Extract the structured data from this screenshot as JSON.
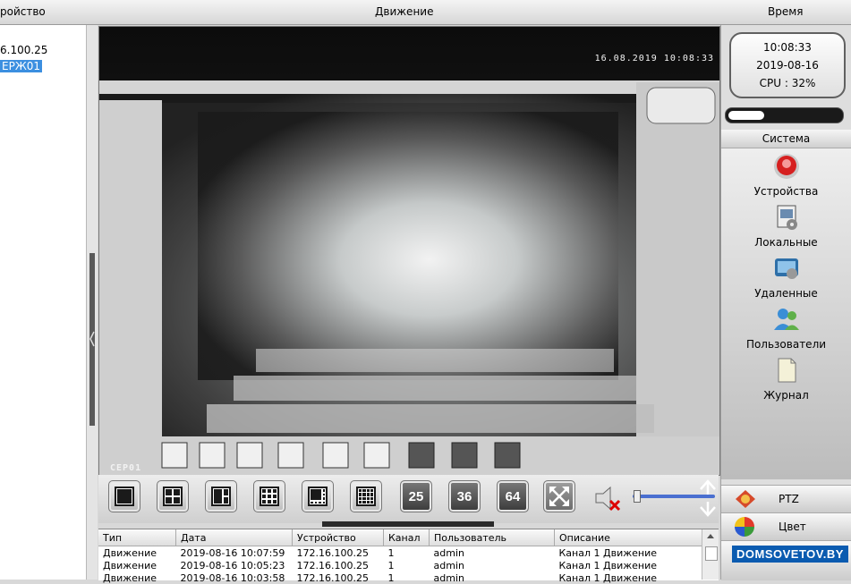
{
  "header": {
    "col_device": "ройство",
    "col_motion": "Движение",
    "col_time": "Время"
  },
  "device_tree": {
    "ip": "6.100.25",
    "selected": "ЕРЖ01"
  },
  "video": {
    "osd_time": "16.08.2019 10:08:33",
    "camera_name": "СЕР01"
  },
  "toolbar": {
    "layouts": [
      "1-view",
      "4-view",
      "6-view",
      "9-view",
      "8-view",
      "16-view"
    ],
    "num_buttons": [
      "25",
      "36",
      "64"
    ],
    "colors": {
      "button_dark": "#3a3a3a",
      "button_light": "#f0f0f0"
    }
  },
  "log": {
    "columns": [
      "Тип",
      "Дата",
      "Устройство",
      "Канал",
      "Пользователь",
      "Описание"
    ],
    "rows": [
      [
        "Движение",
        "2019-08-16 10:07:59",
        "172.16.100.25",
        "1",
        "admin",
        "Канал 1 Движение"
      ],
      [
        "Движение",
        "2019-08-16 10:05:23",
        "172.16.100.25",
        "1",
        "admin",
        "Канал 1 Движение"
      ],
      [
        "Движение",
        "2019-08-16 10:03:58",
        "172.16.100.25",
        "1",
        "admin",
        "Канал 1 Движение"
      ]
    ]
  },
  "status": {
    "time": "10:08:33",
    "date": "2019-08-16",
    "cpu": "CPU : 32%",
    "cpu_level": 0.32
  },
  "system": {
    "header": "Система",
    "items": [
      {
        "label": "Устройства",
        "icon": "devices-icon"
      },
      {
        "label": "Локальные",
        "icon": "local-settings-icon"
      },
      {
        "label": "Удаленные",
        "icon": "remote-settings-icon"
      },
      {
        "label": "Пользователи",
        "icon": "users-icon"
      },
      {
        "label": "Журнал",
        "icon": "log-icon"
      }
    ]
  },
  "bottom_buttons": {
    "ptz": "PTZ",
    "color": "Цвет"
  },
  "watermark": "DOMSOVETOV.BY"
}
